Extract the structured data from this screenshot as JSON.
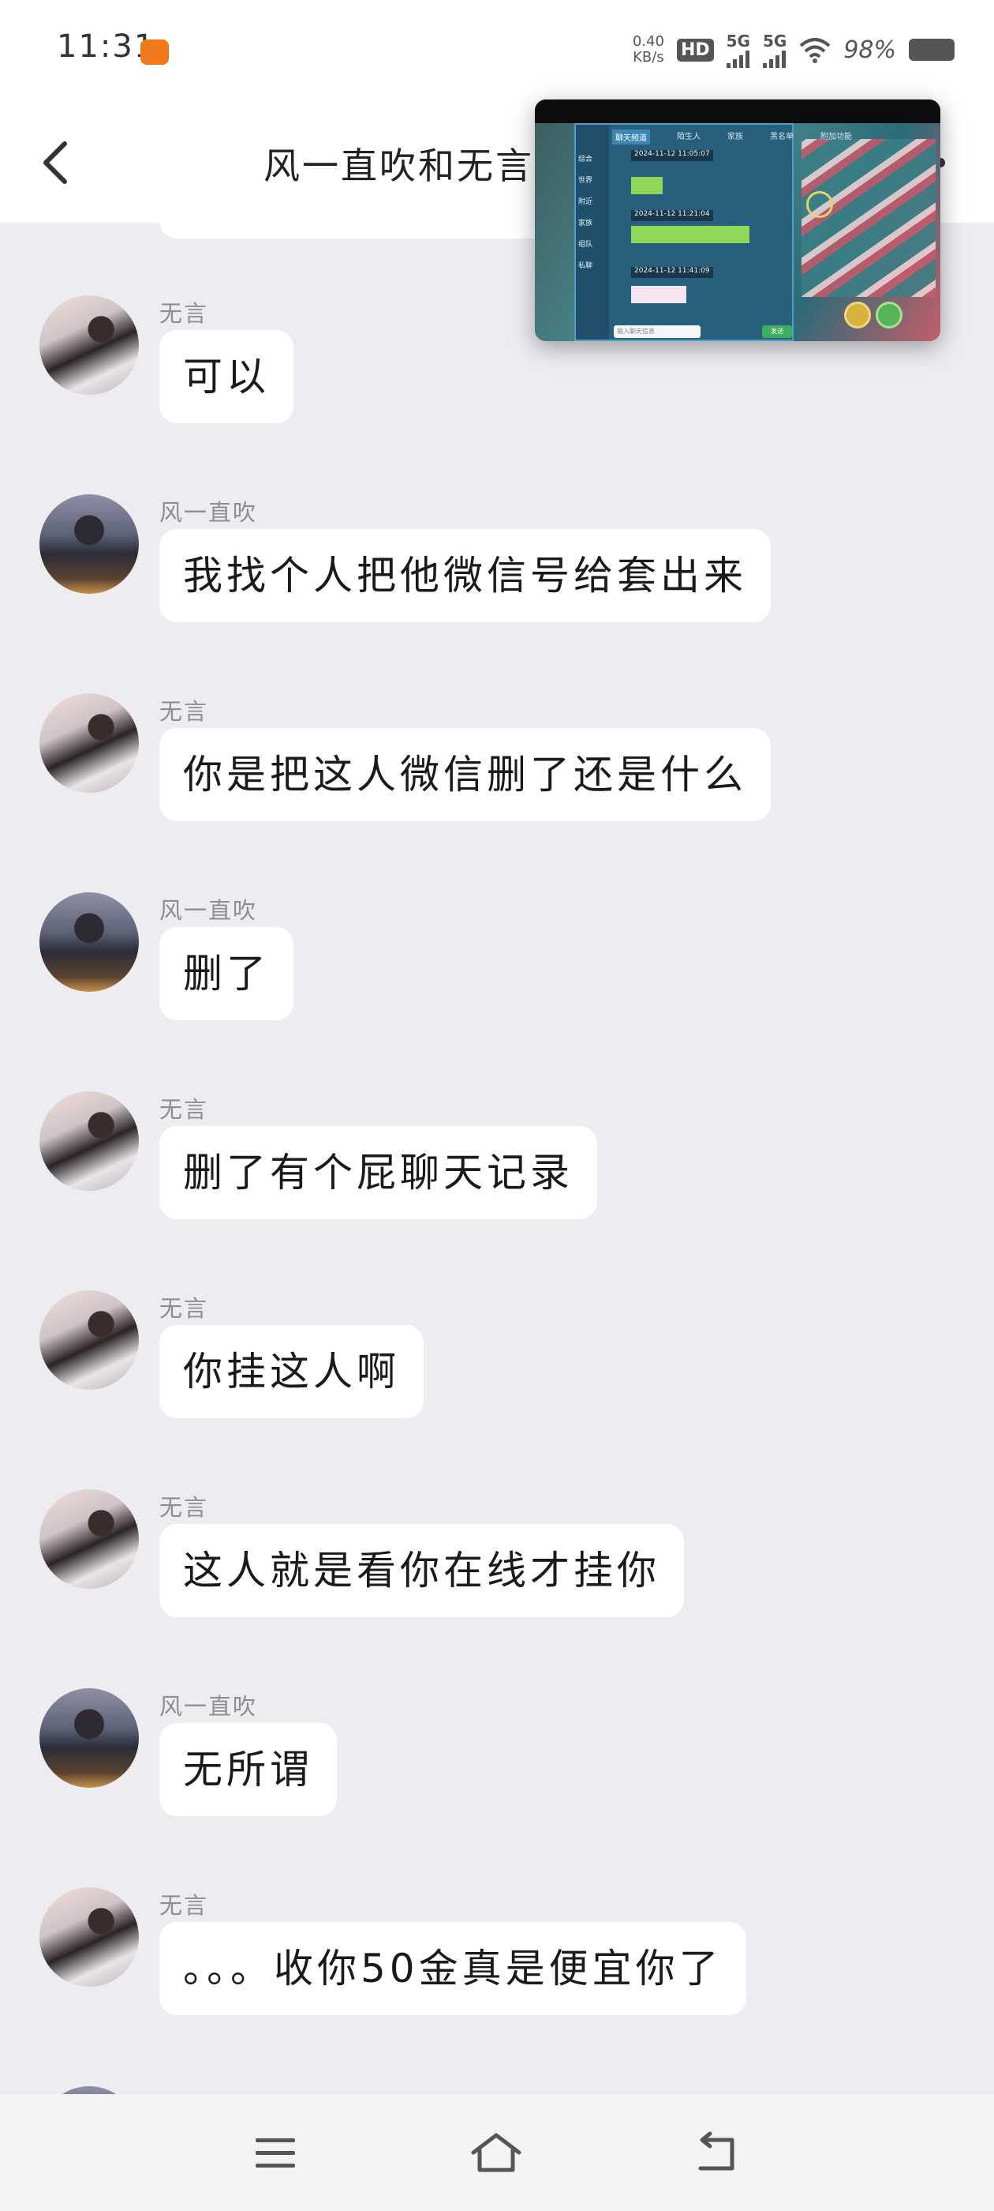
{
  "status_bar": {
    "time": "11:31",
    "net_speed_value": "0.40",
    "net_speed_unit": "KB/s",
    "hd_badge": "HD",
    "hd_sub": "1\n2",
    "signal_1_label": "5G",
    "signal_2_label": "5G",
    "battery_percent": "98%"
  },
  "header": {
    "title": "风一直吹和无言",
    "back_icon": "chevron-left-icon",
    "more_icon": "more-dots-icon"
  },
  "messages": [
    {
      "sender": "无言",
      "text": "可以",
      "avatar": "girl"
    },
    {
      "sender": "风一直吹",
      "text": "我找个人把他微信号给套出来",
      "avatar": "lake"
    },
    {
      "sender": "无言",
      "text": "你是把这人微信删了还是什么",
      "avatar": "girl"
    },
    {
      "sender": "风一直吹",
      "text": "删了",
      "avatar": "lake"
    },
    {
      "sender": "无言",
      "text": "删了有个屁聊天记录",
      "avatar": "girl"
    },
    {
      "sender": "无言",
      "text": "你挂这人啊",
      "avatar": "girl"
    },
    {
      "sender": "无言",
      "text": "这人就是看你在线才挂你",
      "avatar": "girl"
    },
    {
      "sender": "风一直吹",
      "text": "无所谓",
      "avatar": "lake"
    },
    {
      "sender": "无言",
      "text": "。。。收你50金真是便宜你了",
      "avatar": "girl"
    }
  ],
  "floating_window": {
    "tabs": [
      "聊天频道",
      "陌生人",
      "家族",
      "黑名单",
      "附加功能"
    ],
    "side_menu": [
      "综合",
      "世界",
      "附近",
      "家族",
      "组队",
      "私聊"
    ],
    "lines": [
      "2024-11-12 11:05:07",
      "2024-11-12 11:21:04",
      "2024-11-12 11:41:09"
    ],
    "input_placeholder": "输入聊天信息",
    "send_label": "发送"
  },
  "nav_bar": {
    "menu_icon": "menu-icon",
    "home_icon": "home-icon",
    "back_icon": "return-icon"
  }
}
